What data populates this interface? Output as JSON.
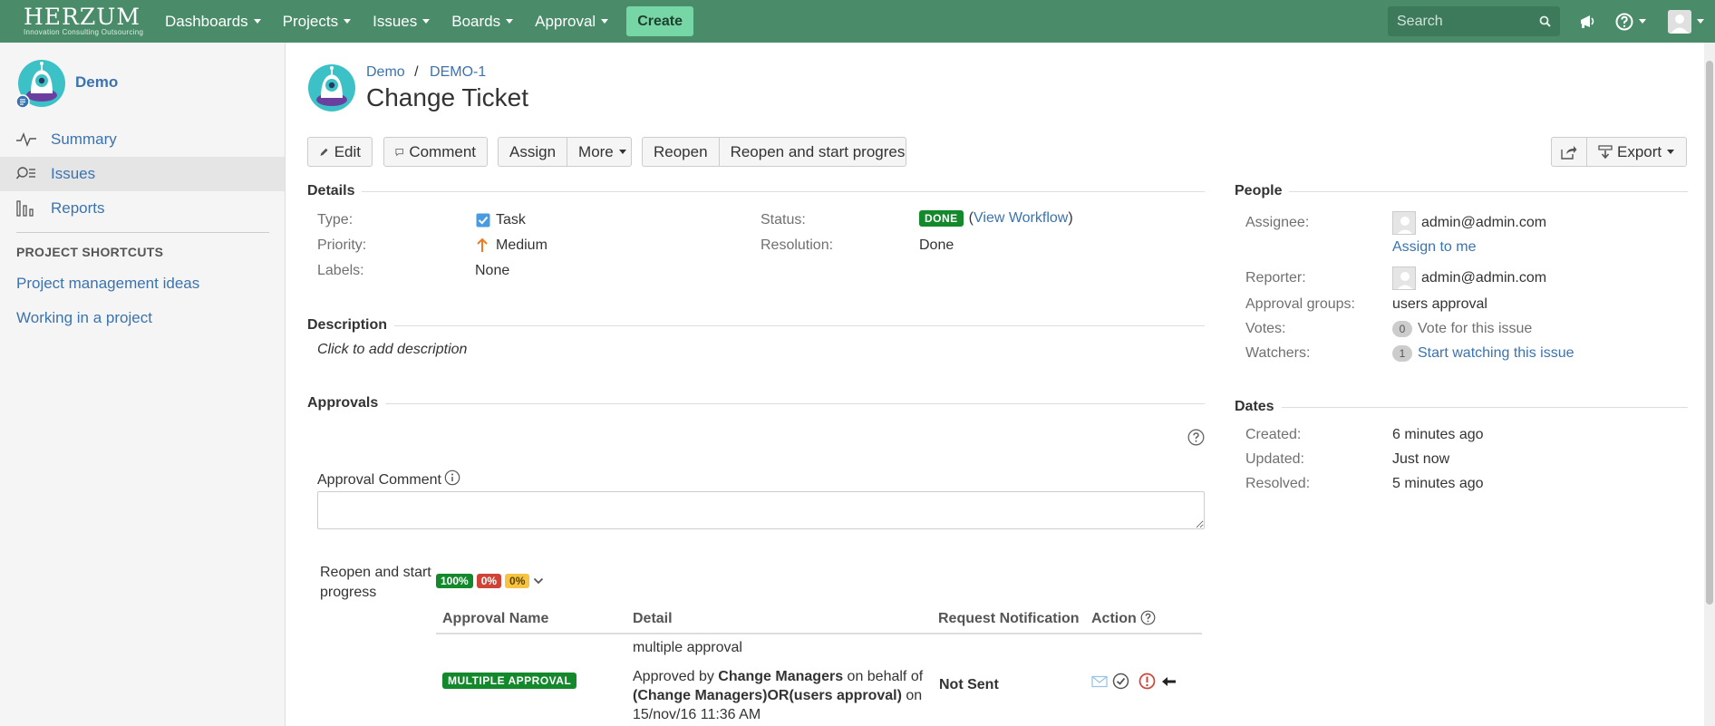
{
  "logo": {
    "main": "HERZUM",
    "sub": "Innovation Consulting Outsourcing"
  },
  "nav": {
    "items": [
      "Dashboards",
      "Projects",
      "Issues",
      "Boards",
      "Approval"
    ],
    "create": "Create",
    "search_placeholder": "Search"
  },
  "sidebar": {
    "project_name": "Demo",
    "items": [
      {
        "label": "Summary"
      },
      {
        "label": "Issues"
      },
      {
        "label": "Reports"
      }
    ],
    "shortcuts_title": "PROJECT SHORTCUTS",
    "shortcuts": [
      "Project management ideas",
      "Working in a project"
    ]
  },
  "issue": {
    "breadcrumb_project": "Demo",
    "breadcrumb_sep": "/",
    "breadcrumb_key": "DEMO-1",
    "title": "Change Ticket"
  },
  "toolbar": {
    "edit": "Edit",
    "comment": "Comment",
    "assign": "Assign",
    "more": "More",
    "reopen": "Reopen",
    "reopen_start": "Reopen and start progress",
    "export": "Export"
  },
  "details": {
    "heading": "Details",
    "type_label": "Type:",
    "type_value": "Task",
    "priority_label": "Priority:",
    "priority_value": "Medium",
    "labels_label": "Labels:",
    "labels_value": "None",
    "status_label": "Status:",
    "status_value": "DONE",
    "view_workflow": "View Workflow",
    "paren_open": "(",
    "paren_close": ")",
    "resolution_label": "Resolution:",
    "resolution_value": "Done"
  },
  "description": {
    "heading": "Description",
    "placeholder": "Click to add description"
  },
  "approvals": {
    "heading": "Approvals",
    "comment_label": "Approval Comment",
    "transition_label_1": "Reopen and start",
    "transition_label_2": "progress",
    "pct_green": "100%",
    "pct_red": "0%",
    "pct_yellow": "0%",
    "columns": [
      "Approval Name",
      "Detail",
      "Request Notification",
      "Action"
    ],
    "row": {
      "header_detail": "multiple approval",
      "name": "MULTIPLE APPROVAL",
      "detail_1_a": "Approved by ",
      "detail_1_b": "Change Managers",
      "detail_1_c": " on behalf of",
      "detail_2_a": "(Change Managers)OR(users approval)",
      "detail_2_b": " on",
      "detail_3": "15/nov/16 11:36 AM",
      "notification": "Not Sent"
    }
  },
  "people": {
    "heading": "People",
    "assignee_label": "Assignee:",
    "assignee_value": "admin@admin.com",
    "assign_to_me": "Assign to me",
    "reporter_label": "Reporter:",
    "reporter_value": "admin@admin.com",
    "groups_label": "Approval groups:",
    "groups_value": "users approval",
    "votes_label": "Votes:",
    "votes_count": "0",
    "votes_link": "Vote for this issue",
    "watchers_label": "Watchers:",
    "watchers_count": "1",
    "watchers_link": "Start watching this issue"
  },
  "dates": {
    "heading": "Dates",
    "created_label": "Created:",
    "created_value": "6 minutes ago",
    "updated_label": "Updated:",
    "updated_value": "Just now",
    "resolved_label": "Resolved:",
    "resolved_value": "5 minutes ago"
  },
  "colors": {
    "nav": "#4a8c6a",
    "link": "#3b73af",
    "done": "#14892c",
    "red": "#d04437",
    "yellow": "#f6c342"
  }
}
